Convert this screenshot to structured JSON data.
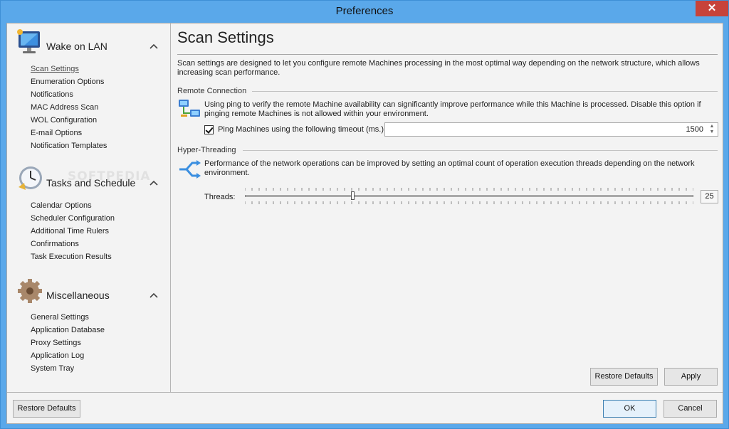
{
  "window": {
    "title": "Preferences",
    "close_glyph": "✕"
  },
  "sidebar": {
    "groups": [
      {
        "title": "Wake on LAN",
        "icon": "monitor-icon",
        "items": [
          "Scan Settings",
          "Enumeration Options",
          "Notifications",
          "MAC Address Scan",
          "WOL Configuration",
          "E-mail Options",
          "Notification Templates"
        ]
      },
      {
        "title": "Tasks and Schedule",
        "icon": "clock-icon",
        "items": [
          "Calendar Options",
          "Scheduler Configuration",
          "Additional Time Rulers",
          "Confirmations",
          "Task Execution Results"
        ]
      },
      {
        "title": "Miscellaneous",
        "icon": "gear-icon",
        "items": [
          "General Settings",
          "Application Database",
          "Proxy Settings",
          "Application Log",
          "System Tray"
        ]
      }
    ],
    "active_item": "Scan Settings",
    "watermark": "SOFTPEDIA"
  },
  "main": {
    "title": "Scan Settings",
    "description": "Scan settings are designed to let you configure remote Machines processing in the most optimal way depending on the network structure, which allows increasing scan performance.",
    "remote_connection": {
      "heading": "Remote Connection",
      "text": "Using ping to verify the remote Machine availability can significantly improve performance while this Machine is processed. Disable this option if pinging remote Machines is not allowed within your environment.",
      "checkbox_label": "Ping Machines using the following timeout (ms.):",
      "checked": true,
      "timeout_value": "1500"
    },
    "hyper_threading": {
      "heading": "Hyper-Threading",
      "text": "Performance of the network operations can be improved by setting an optimal count of operation execution threads depending on the network environment.",
      "threads_label": "Threads:",
      "threads_value": "25",
      "slider_fraction": 0.24
    },
    "restore_defaults_label": "Restore Defaults",
    "apply_label": "Apply"
  },
  "footer": {
    "restore_defaults_label": "Restore Defaults",
    "ok_label": "OK",
    "cancel_label": "Cancel"
  },
  "colors": {
    "title_bar": "#5aa8ea",
    "close_button": "#c7433a",
    "client_bg": "#f3f3f3"
  }
}
